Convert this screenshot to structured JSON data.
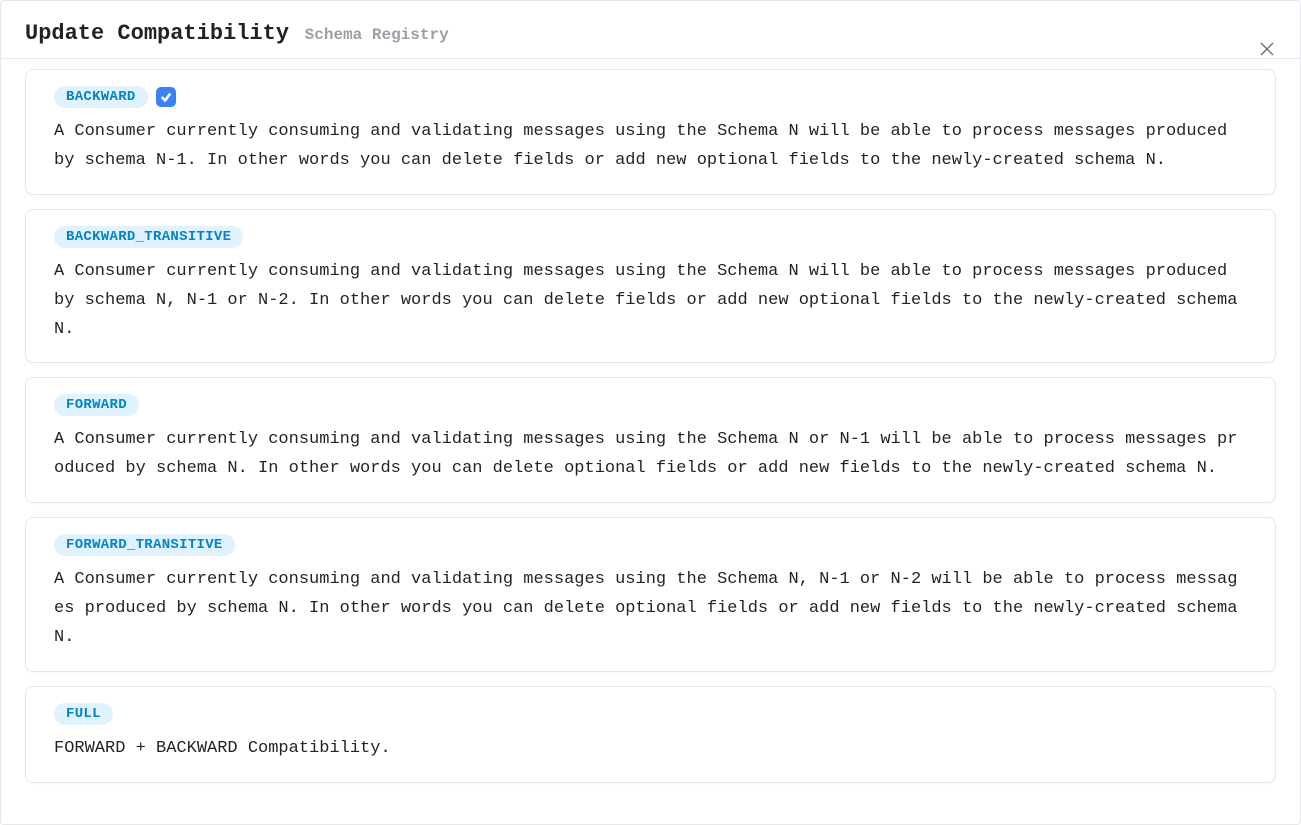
{
  "header": {
    "title": "Update Compatibility",
    "subtitle": "Schema Registry"
  },
  "options": [
    {
      "key": "backward",
      "label": "BACKWARD",
      "selected": true,
      "description": "A Consumer currently consuming and validating messages using the Schema N will be able to process messages produced by schema N-1. In other words you can delete fields or add new optional fields to the newly-created schema N."
    },
    {
      "key": "backward-transitive",
      "label": "BACKWARD_TRANSITIVE",
      "selected": false,
      "description": "A Consumer currently consuming and validating messages using the Schema N will be able to process messages produced by schema N, N-1 or N-2. In other words you can delete fields or add new optional fields to the newly-created schema N."
    },
    {
      "key": "forward",
      "label": "FORWARD",
      "selected": false,
      "description": "A Consumer currently consuming and validating messages using the Schema N or N-1 will be able to process messages produced by schema N. In other words you can delete optional fields or add new fields to the newly-created schema N."
    },
    {
      "key": "forward-transitive",
      "label": "FORWARD_TRANSITIVE",
      "selected": false,
      "description": "A Consumer currently consuming and validating messages using the Schema N, N-1 or N-2 will be able to process messages produced by schema N. In other words you can delete optional fields or add new fields to the newly-created schema N."
    },
    {
      "key": "full",
      "label": "FULL",
      "selected": false,
      "description": "FORWARD + BACKWARD Compatibility."
    }
  ]
}
